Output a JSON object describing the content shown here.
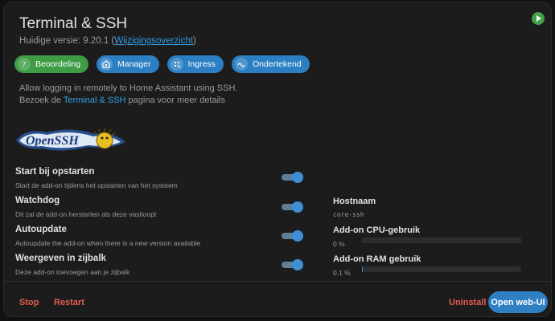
{
  "header": {
    "title": "Terminal & SSH",
    "version_prefix": "Huidige versie: 9.20.1 (",
    "changelog_link": "Wijzigingsoverzicht",
    "version_suffix": ")"
  },
  "chips": [
    {
      "label": "Beoordeling",
      "icon": "7",
      "color": "#3e9c45"
    },
    {
      "label": "Manager",
      "icon": "manager-icon",
      "color": "#2b7fc2"
    },
    {
      "label": "Ingress",
      "icon": "ingress-icon",
      "color": "#2b7fc2"
    },
    {
      "label": "Ondertekend",
      "icon": "signed-icon",
      "color": "#2b7fc2"
    }
  ],
  "description": {
    "line1": "Allow logging in remotely to Home Assistant using SSH.",
    "line2_prefix": "Bezoek de ",
    "line2_link": "Terminal & SSH",
    "line2_suffix": " pagina voor meer details"
  },
  "logo": {
    "text": "OpenSSH"
  },
  "options": [
    {
      "label": "Start bij opstarten",
      "desc": "Start de add-on tijdens het opstarten van het systeem",
      "enabled": true
    },
    {
      "label": "Watchdog",
      "desc": "Dit zal de add-on herstarten als deze vastloopt",
      "enabled": true
    },
    {
      "label": "Autoupdate",
      "desc": "Autoupdate the add-on when there is a new version available",
      "enabled": true
    },
    {
      "label": "Weergeven in zijbalk",
      "desc": "Deze add-on toevoegen aan je zijbalk",
      "enabled": true
    }
  ],
  "info": {
    "hostname_label": "Hostnaam",
    "hostname_value": "core-ssh",
    "cpu_label": "Add-on CPU-gebruik",
    "cpu_value": "0 %",
    "cpu_fraction": 0,
    "ram_label": "Add-on RAM gebruik",
    "ram_value": "0.1 %",
    "ram_fraction": 0.001
  },
  "actions": {
    "stop": "Stop",
    "restart": "Restart",
    "uninstall": "Uninstall",
    "open_web_ui": "Open web-UI"
  },
  "colors": {
    "accent": "#2f7fc3",
    "danger": "#e25c4f",
    "success": "#3e9c45"
  }
}
